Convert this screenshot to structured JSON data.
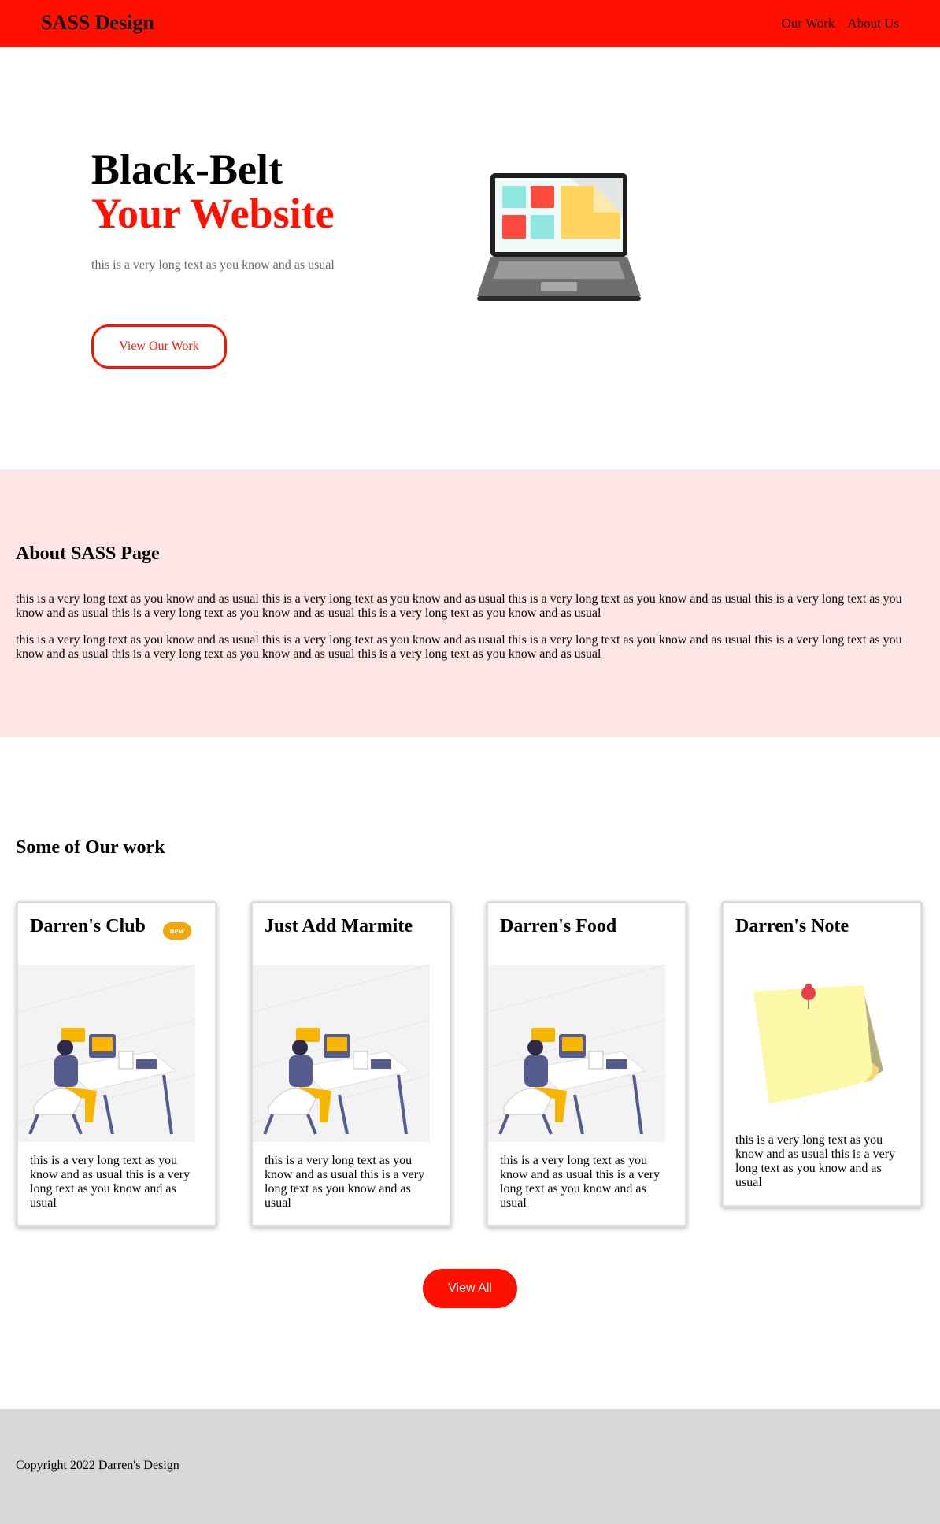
{
  "nav": {
    "brand": "SASS Design",
    "links": [
      "Our Work",
      "About Us"
    ]
  },
  "hero": {
    "title_line1": "Black-Belt",
    "title_line2": "Your Website",
    "subtitle": "this is a very long text as you know and as usual",
    "button_label": "View Our Work"
  },
  "about": {
    "title": "About SASS Page",
    "paragraphs": [
      "this is a very long text as you know and as usual this is a very long text as you know and as usual this is a very long text as you know and as usual this is a very long text as you know and as usual this is a very long text as you know and as usual this is a very long text as you know and as usual",
      "this is a very long text as you know and as usual this is a very long text as you know and as usual this is a very long text as you know and as usual this is a very long text as you know and as usual this is a very long text as you know and as usual this is a very long text as you know and as usual"
    ]
  },
  "work": {
    "title": "Some of Our work",
    "cards": [
      {
        "title": "Darren's Club",
        "badge": "new",
        "image": "developer-illustration",
        "text": "this is a very long text as you know and as usual this is a very long text as you know and as usual"
      },
      {
        "title": "Just Add Marmite",
        "image": "developer-illustration",
        "text": "this is a very long text as you know and as usual this is a very long text as you know and as usual"
      },
      {
        "title": "Darren's Food",
        "image": "developer-illustration",
        "text": "this is a very long text as you know and as usual this is a very long text as you know and as usual"
      },
      {
        "title": "Darren's Note",
        "image": "sticky-note-illustration",
        "text": "this is a very long text as you know and as usual this is a very long text as you know and as usual"
      }
    ],
    "view_all_label": "View All"
  },
  "footer": {
    "copyright": "Copyright 2022 Darren's Design"
  },
  "colors": {
    "primary": "#ff1100",
    "about_bg": "#fde5e5",
    "footer_bg": "#d8d8d8",
    "badge": "#f5a70a"
  }
}
